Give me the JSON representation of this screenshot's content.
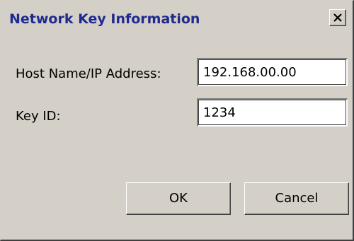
{
  "window": {
    "title": "Network Key Information",
    "close_icon": "close-icon",
    "title_color": "#1f2a8f",
    "background": "#d4d0c8"
  },
  "form": {
    "host_label": "Host Name/IP Address:",
    "host_value": "192.168.00.00",
    "key_label": "Key ID:",
    "key_value": "1234"
  },
  "buttons": {
    "ok_label": "OK",
    "cancel_label": "Cancel"
  }
}
